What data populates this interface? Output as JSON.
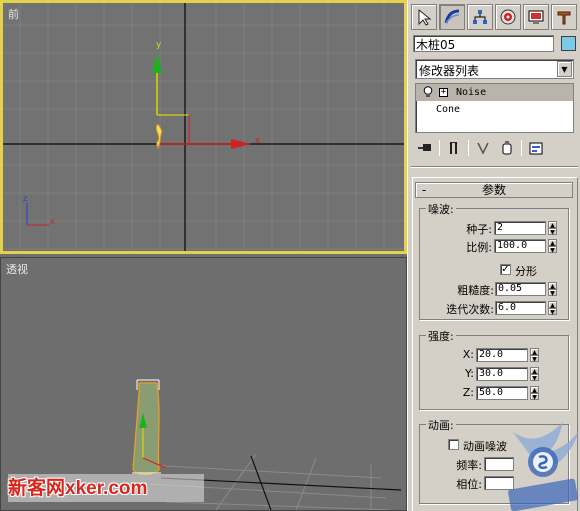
{
  "viewports": {
    "front": {
      "label": "前",
      "axis_y": "y",
      "axis_x": "x",
      "mini_axis_z": "z",
      "mini_axis_x": "x"
    },
    "perspective": {
      "label": "透视"
    }
  },
  "command_panel": {
    "tabs": [
      "create-icon",
      "modify-icon",
      "hierarchy-icon",
      "motion-icon",
      "display-icon",
      "utilities-icon"
    ],
    "object_name": "木桩05",
    "object_color": "#7ccae8",
    "modifier_list": "修改器列表",
    "stack": [
      {
        "label": "Noise",
        "selected": true
      },
      {
        "label": "Cone",
        "selected": false
      }
    ],
    "stack_tools": [
      "pin-stack-icon",
      "show-end-result-icon",
      "make-unique-icon",
      "remove-modifier-icon",
      "configure-modifier-sets-icon"
    ]
  },
  "params": {
    "rollout_title": "参数",
    "rollout_sign": "-",
    "noise_group": "噪波:",
    "seed_label": "种子:",
    "seed_value": "2",
    "scale_label": "比例:",
    "scale_value": "100.0",
    "fractal_label": "分形",
    "fractal_checked": true,
    "roughness_label": "粗糙度:",
    "roughness_value": "0.05",
    "iterations_label": "迭代次数:",
    "iterations_value": "6.0",
    "strength_group": "强度:",
    "x_label": "X:",
    "x_value": "20.0",
    "y_label": "Y:",
    "y_value": "30.0",
    "z_label": "Z:",
    "z_value": "50.0",
    "animation_group": "动画:",
    "animate_noise_label": "动画噪波",
    "animate_noise_checked": false,
    "frequency_label": "频率:",
    "phase_label": "相位:"
  },
  "watermark": {
    "site_cn": "新客网",
    "site_en": "xker.com",
    "seal_text": "兰月联盟"
  }
}
